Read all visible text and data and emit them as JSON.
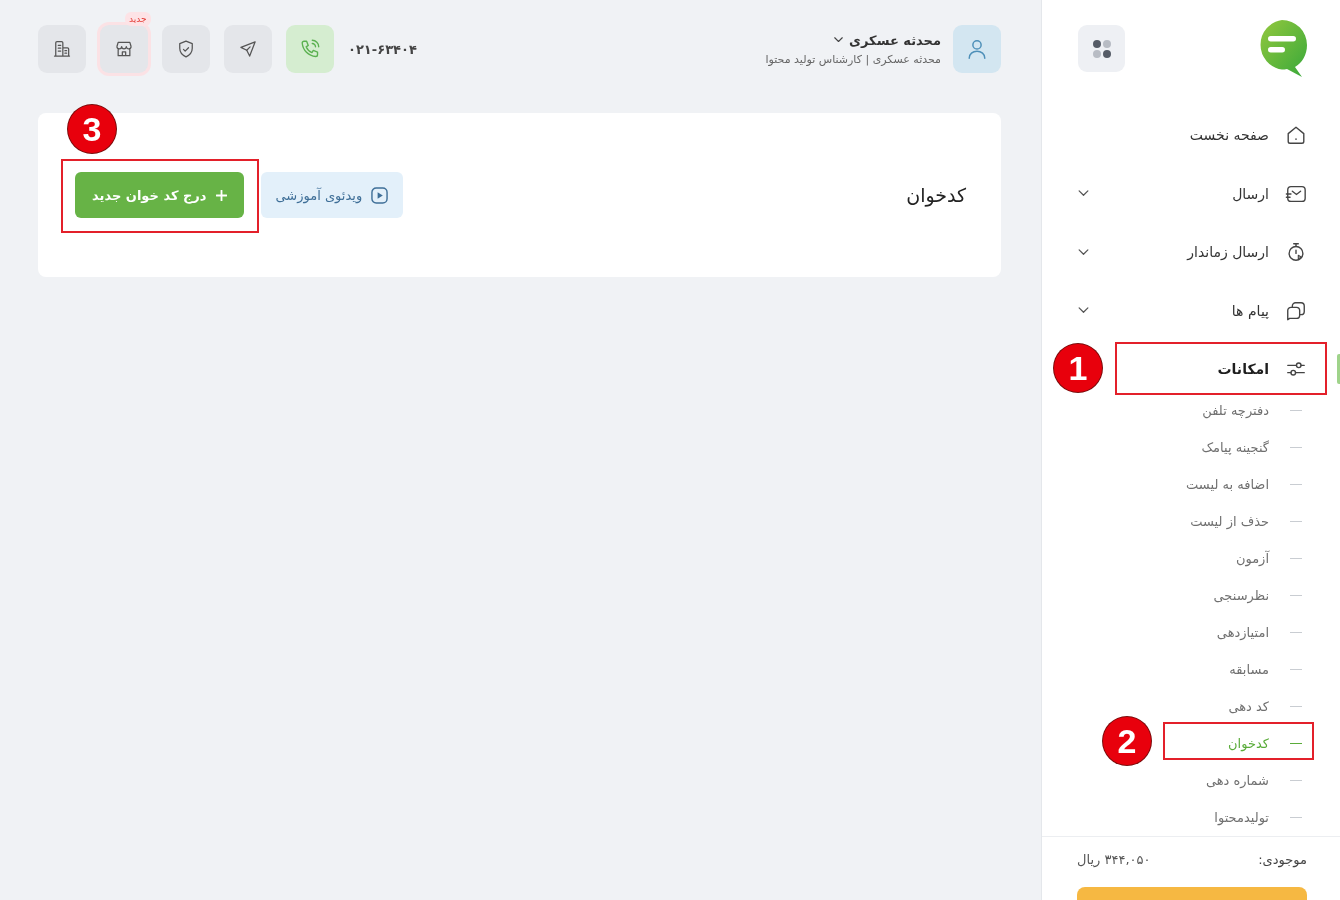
{
  "sidebar": {
    "nav": [
      {
        "kind": "home",
        "label": "صفحه نخست",
        "selected": false
      },
      {
        "kind": "send",
        "label": "ارسال",
        "selected": false,
        "expanded": false
      },
      {
        "kind": "timer",
        "label": "ارسال زماندار",
        "selected": false,
        "expanded": false
      },
      {
        "kind": "messages",
        "label": "پیام ها",
        "selected": false,
        "expanded": false
      },
      {
        "kind": "features",
        "label": "امکانات",
        "selected": true,
        "expanded": true,
        "callout": "1",
        "children": [
          {
            "label": "دفترچه تلفن",
            "selected": false
          },
          {
            "label": "گنجینه پیامک",
            "selected": false
          },
          {
            "label": "اضافه به لیست",
            "selected": false
          },
          {
            "label": "حذف از لیست",
            "selected": false
          },
          {
            "label": "آزمون",
            "selected": false
          },
          {
            "label": "نظرسنجی",
            "selected": false
          },
          {
            "label": "امتیازدهی",
            "selected": false
          },
          {
            "label": "مسابقه",
            "selected": false
          },
          {
            "label": "کد دهی",
            "selected": false
          },
          {
            "label": "کدخوان",
            "selected": true,
            "callout": "2"
          },
          {
            "label": "شماره دهی",
            "selected": false
          },
          {
            "label": "تولیدمحتوا",
            "selected": false
          }
        ]
      }
    ],
    "balance": {
      "label": "موجودی:",
      "value": "۳۴۴,۰۵۰ ریال"
    }
  },
  "header": {
    "user": {
      "name": "محدثه عسکری",
      "subtitle": "محدثه عسکری | کارشناس تولید محتوا"
    },
    "phone_number": "۰۲۱-۶۳۴۰۴",
    "toolbar": [
      {
        "kind": "phone"
      },
      {
        "kind": "send"
      },
      {
        "kind": "shield"
      },
      {
        "kind": "shop",
        "badge": "جدید"
      },
      {
        "kind": "building"
      }
    ]
  },
  "page": {
    "title": "کدخوان",
    "buttons": [
      {
        "kind": "video",
        "label": "ویدئوی آموزشی"
      },
      {
        "kind": "add",
        "label": "درج کد خوان جدید",
        "callout": "3"
      }
    ]
  }
}
